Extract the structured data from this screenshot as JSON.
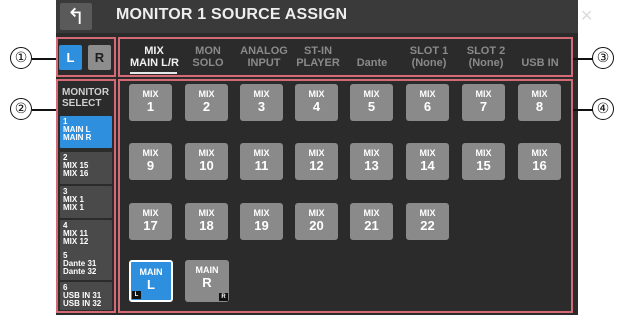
{
  "window": {
    "title": "MONITOR 1 SOURCE ASSIGN",
    "back_icon": "↰",
    "close_icon": "✕"
  },
  "callouts": [
    "①",
    "②",
    "③",
    "④"
  ],
  "lr": {
    "left_label": "L",
    "right_label": "R",
    "selected": "L"
  },
  "tabs": [
    {
      "line1": "MIX",
      "line2": "MAIN L/R",
      "active": true
    },
    {
      "line1": "MON",
      "line2": "SOLO",
      "active": false
    },
    {
      "line1": "ANALOG",
      "line2": "INPUT",
      "active": false
    },
    {
      "line1": "ST-IN",
      "line2": "PLAYER",
      "active": false
    },
    {
      "line1": "",
      "line2": "Dante",
      "active": false
    },
    {
      "line1": "SLOT 1",
      "line2": "(None)",
      "active": false
    },
    {
      "line1": "SLOT 2",
      "line2": "(None)",
      "active": false
    },
    {
      "line1": "",
      "line2": "USB IN",
      "active": false
    }
  ],
  "monitor_select": {
    "label_line1": "MONITOR",
    "label_line2": "SELECT",
    "items": [
      {
        "num": "1",
        "a": "MAIN L",
        "b": "MAIN R",
        "active": true
      },
      {
        "num": "2",
        "a": "MIX 15",
        "b": "MIX 16",
        "active": false
      },
      {
        "num": "3",
        "a": "MIX 1",
        "b": "MIX 1",
        "active": false
      },
      {
        "num": "4",
        "a": "MIX 11",
        "b": "MIX 12",
        "active": false
      },
      {
        "num": "5",
        "a": "Dante 31",
        "b": "Dante 32",
        "active": false
      },
      {
        "num": "6",
        "a": "USB IN 31",
        "b": "USB IN 32",
        "active": false
      }
    ]
  },
  "sources": {
    "mix_prefix": "MIX",
    "mix_numbers": [
      "1",
      "2",
      "3",
      "4",
      "5",
      "6",
      "7",
      "8",
      "9",
      "10",
      "11",
      "12",
      "13",
      "14",
      "15",
      "16",
      "17",
      "18",
      "19",
      "20",
      "21",
      "22"
    ],
    "main_l": {
      "line1": "MAIN",
      "line2": "L",
      "tag": "L",
      "active": true
    },
    "main_r": {
      "line1": "MAIN",
      "line2": "R",
      "tag": "R",
      "active": false
    }
  },
  "colors": {
    "accent_blue": "#2f8fdf",
    "callout_frame": "#d46a75",
    "button_gray": "#8a8a8a",
    "background": "#2b2b2b"
  }
}
